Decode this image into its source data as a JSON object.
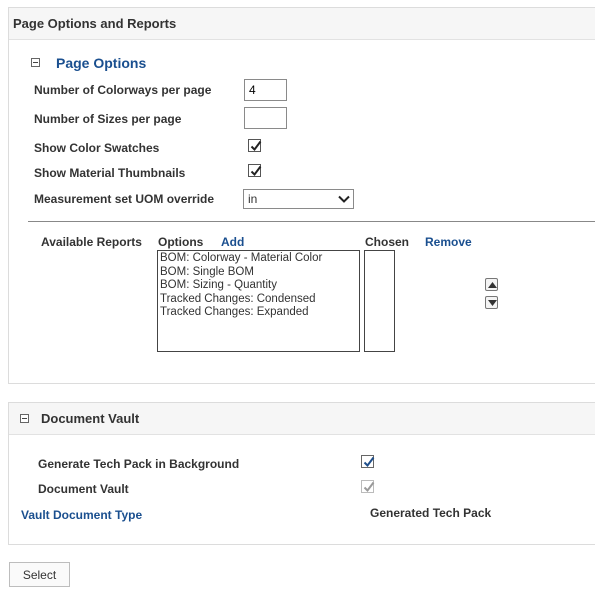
{
  "page_options_panel": {
    "title": "Page Options and Reports",
    "section_title": "Page Options",
    "colorways_label": "Number of Colorways per page",
    "colorways_value": "4",
    "sizes_label": "Number of Sizes per page",
    "sizes_value": "",
    "show_swatches_label": "Show Color Swatches",
    "show_swatches_checked": true,
    "show_thumbnails_label": "Show Material Thumbnails",
    "show_thumbnails_checked": true,
    "uom_label": "Measurement set UOM override",
    "uom_value": "in",
    "reports": {
      "available_label": "Available Reports",
      "options_label": "Options",
      "add_label": "Add",
      "chosen_label": "Chosen",
      "remove_label": "Remove",
      "options": [
        "BOM: Colorway - Material Color",
        "BOM: Single BOM",
        "BOM: Sizing - Quantity",
        "Tracked Changes: Condensed",
        "Tracked Changes: Expanded"
      ],
      "chosen": []
    }
  },
  "document_vault_panel": {
    "title": "Document Vault",
    "generate_label": "Generate Tech Pack in Background",
    "generate_checked": true,
    "vault_label": "Document Vault",
    "vault_checked": true,
    "vault_type_label": "Vault Document Type",
    "vault_type_value": "Generated Tech Pack"
  },
  "select_button_label": "Select",
  "colors": {
    "link": "#1a4f8f",
    "check_blue": "#1f4f8b",
    "check_gray": "#9a9a9a"
  }
}
